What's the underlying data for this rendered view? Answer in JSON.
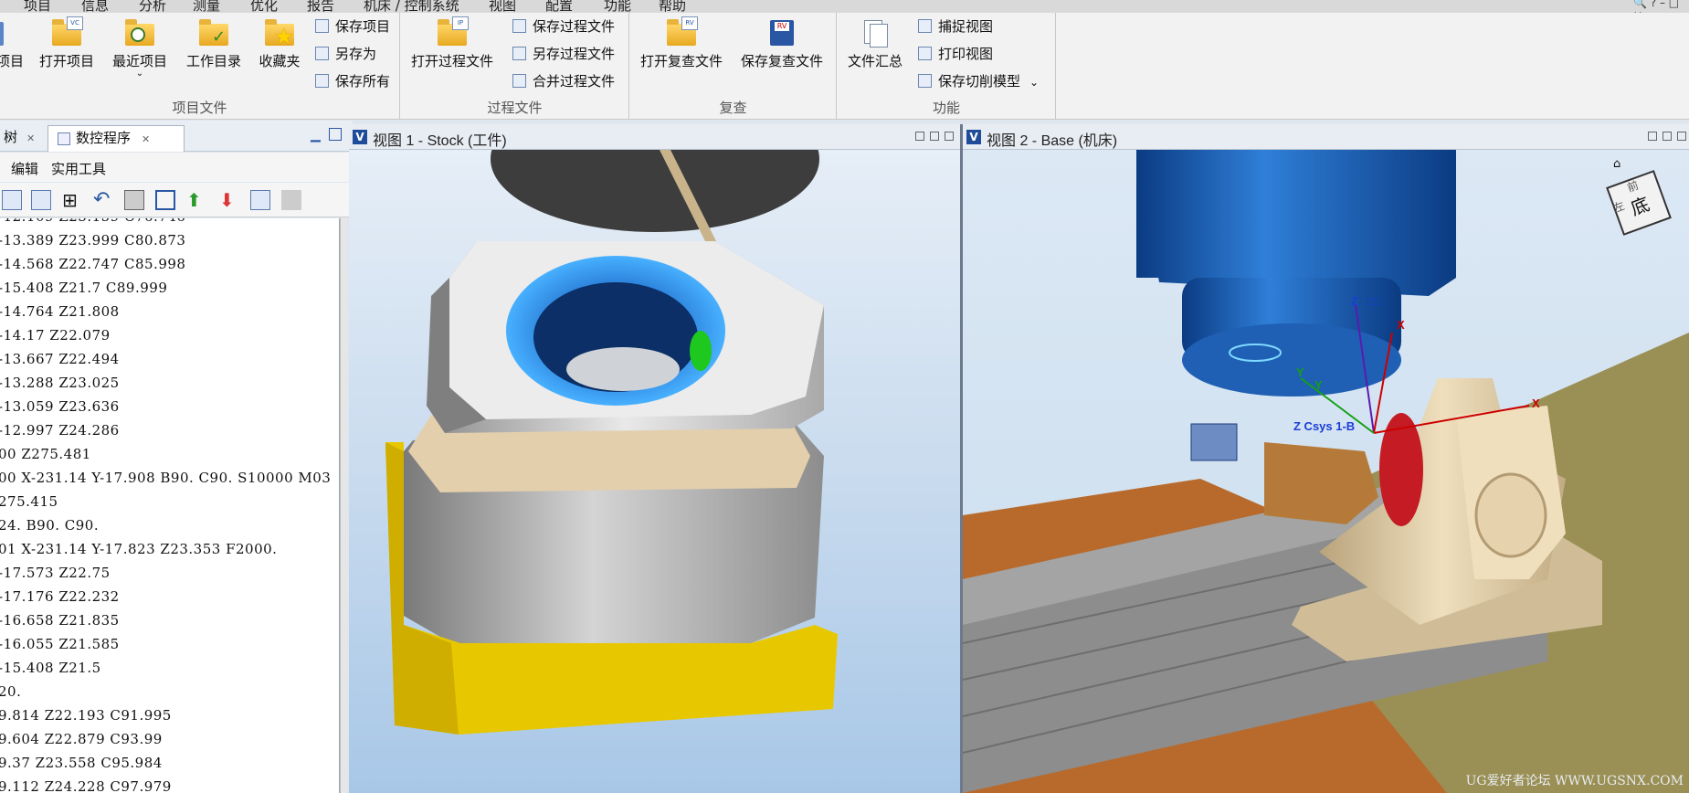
{
  "menu": {
    "items": [
      "项目",
      "信息",
      "分析",
      "测量",
      "优化",
      "报告",
      "机床 / 控制系统",
      "视图",
      "配置",
      "功能",
      "帮助"
    ],
    "window_controls": "🔍 ? – □ ✕"
  },
  "ribbon": {
    "groups": [
      {
        "label": "项目文件"
      },
      {
        "label": "过程文件"
      },
      {
        "label": "复查"
      },
      {
        "label": "功能"
      }
    ],
    "project": {
      "new_partial": "项目",
      "open": "打开项目",
      "recent": "最近项目",
      "workdir": "工作目录",
      "favorites": "收藏夹",
      "save": "保存项目",
      "save_as": "另存为",
      "save_all": "保存所有"
    },
    "process": {
      "open": "打开过程文件",
      "save": "保存过程文件",
      "save_as": "另存过程文件",
      "merge": "合并过程文件"
    },
    "review": {
      "open": "打开复查文件",
      "save": "保存复查文件"
    },
    "function": {
      "summary": "文件汇总",
      "capture": "捕捉视图",
      "print": "打印视图",
      "save_cut": "保存切削模型"
    },
    "icon_badges": {
      "vc": "VC",
      "ip": "IP",
      "rv": "RV"
    }
  },
  "left_panel": {
    "tab_tree": "树",
    "tab_nc": "数控程序",
    "menu_edit": "编辑",
    "menu_tools": "实用工具",
    "code_lines": [
      "-12.109 Z23.159 C76.746",
      "-13.389 Z23.999 C80.873",
      "-14.568 Z22.747 C85.998",
      "-15.408 Z21.7 C89.999",
      "-14.764 Z21.808",
      "-14.17 Z22.079",
      "-13.667 Z22.494",
      "-13.288 Z23.025",
      "-13.059 Z23.636",
      "-12.997 Z24.286",
      "00 Z275.481",
      "00 X-231.14 Y-17.908 B90. C90. S10000 M03",
      "275.415",
      "24. B90. C90.",
      "01 X-231.14 Y-17.823 Z23.353 F2000.",
      "-17.573 Z22.75",
      "-17.176 Z22.232",
      "-16.658 Z21.835",
      "-16.055 Z21.585",
      "-15.408 Z21.5",
      "20.",
      "9.814 Z22.193 C91.995",
      "9.604 Z22.879 C93.99",
      "9.37 Z23.558 C95.984",
      "9.112 Z24.228 C97.979"
    ]
  },
  "views": {
    "view1_title": "视图 1 - Stock (工件)",
    "view2_title": "视图 2 - Base (机床)",
    "logo": "V",
    "axis_z": "Z",
    "axis_z_suffix": "□□",
    "axis_x": "X",
    "axis_y": "Y",
    "csys_label": "Z Csys 1-B",
    "cube_face_top": "前",
    "cube_face_front": "底",
    "cube_face_side": "左"
  },
  "watermark": "UG爱好者论坛 WWW.UGSNX.COM"
}
